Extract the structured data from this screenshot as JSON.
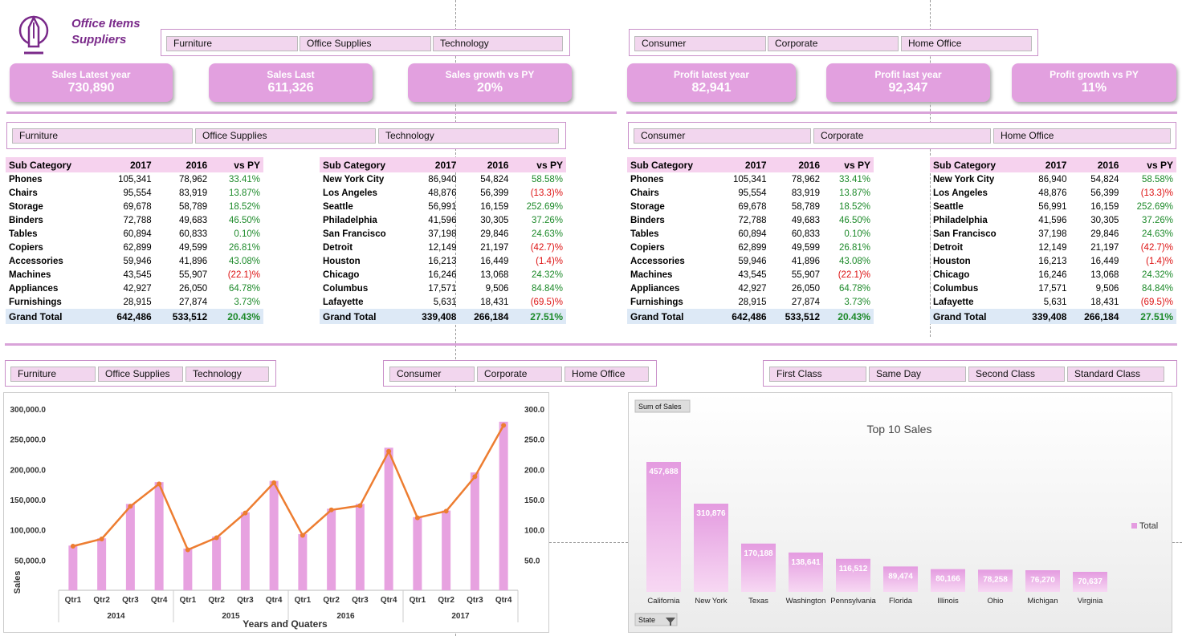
{
  "logo": {
    "line1": "Office Items",
    "line2": "Suppliers"
  },
  "slicers": {
    "category": [
      "Furniture",
      "Office Supplies",
      "Technology"
    ],
    "segment": [
      "Consumer",
      "Corporate",
      "Home Office"
    ],
    "ship_mode": [
      "First Class",
      "Same Day",
      "Second Class",
      "Standard Class"
    ]
  },
  "kpis": [
    {
      "title": "Sales Latest year",
      "value": "730,890"
    },
    {
      "title": "Sales Last",
      "value": "611,326"
    },
    {
      "title": "Sales growth vs PY",
      "value": "20%"
    },
    {
      "title": "Profit latest year",
      "value": "82,941"
    },
    {
      "title": "Profit  last year",
      "value": "92,347"
    },
    {
      "title": "Profit growth vs PY",
      "value": "11%"
    }
  ],
  "table_sub": {
    "headers": [
      "Sub Category",
      "2017",
      "2016",
      "vs PY"
    ],
    "rows": [
      [
        "Phones",
        "105,341",
        "78,962",
        "33.41%"
      ],
      [
        "Chairs",
        "95,554",
        "83,919",
        "13.87%"
      ],
      [
        "Storage",
        "69,678",
        "58,789",
        "18.52%"
      ],
      [
        "Binders",
        "72,788",
        "49,683",
        "46.50%"
      ],
      [
        "Tables",
        "60,894",
        "60,833",
        "0.10%"
      ],
      [
        "Copiers",
        "62,899",
        "49,599",
        "26.81%"
      ],
      [
        "Accessories",
        "59,946",
        "41,896",
        "43.08%"
      ],
      [
        "Machines",
        "43,545",
        "55,907",
        "(22.1)%"
      ],
      [
        "Appliances",
        "42,927",
        "26,050",
        "64.78%"
      ],
      [
        "Furnishings",
        "28,915",
        "27,874",
        "3.73%"
      ]
    ],
    "total": [
      "Grand Total",
      "642,486",
      "533,512",
      "20.43%"
    ]
  },
  "table_city": {
    "headers": [
      "Sub Category",
      "2017",
      "2016",
      "vs PY"
    ],
    "rows": [
      [
        "New York City",
        "86,940",
        "54,824",
        "58.58%"
      ],
      [
        "Los Angeles",
        "48,876",
        "56,399",
        "(13.3)%"
      ],
      [
        "Seattle",
        "56,991",
        "16,159",
        "252.69%"
      ],
      [
        "Philadelphia",
        "41,596",
        "30,305",
        "37.26%"
      ],
      [
        "San Francisco",
        "37,198",
        "29,846",
        "24.63%"
      ],
      [
        "Detroit",
        "12,149",
        "21,197",
        "(42.7)%"
      ],
      [
        "Houston",
        "16,213",
        "16,449",
        "(1.4)%"
      ],
      [
        "Chicago",
        "16,246",
        "13,068",
        "24.32%"
      ],
      [
        "Columbus",
        "17,571",
        "9,506",
        "84.84%"
      ],
      [
        "Lafayette",
        "5,631",
        "18,431",
        "(69.5)%"
      ]
    ],
    "total": [
      "Grand Total",
      "339,408",
      "266,184",
      "27.51%"
    ]
  },
  "colors": {
    "accent": "#e2a0df",
    "bar": "#e7a2e0",
    "line": "#ed7d31",
    "positive": "#1d8a2a",
    "negative": "#dd1111"
  },
  "chart_data": [
    {
      "type": "bar",
      "combo_line": true,
      "ylabel": "Sales",
      "xlabel": "Years and Quaters",
      "ylim": [
        0,
        300000
      ],
      "y_ticks_left": [
        "",
        "50,000.0",
        "100,000.0",
        "150,000.0",
        "200,000.0",
        "250,000.0",
        "300,000.0"
      ],
      "y_ticks_right": [
        "",
        "50.0",
        "100.0",
        "150.0",
        "200.0",
        "250.0",
        "300.0"
      ],
      "years": [
        "2014",
        "2015",
        "2016",
        "2017"
      ],
      "categories": [
        "Qtr1",
        "Qtr2",
        "Qtr3",
        "Qtr4",
        "Qtr1",
        "Qtr2",
        "Qtr3",
        "Qtr4",
        "Qtr1",
        "Qtr2",
        "Qtr3",
        "Qtr4",
        "Qtr1",
        "Qtr2",
        "Qtr3",
        "Qtr4"
      ],
      "values": [
        74000,
        86000,
        143000,
        179000,
        69000,
        89000,
        129000,
        181000,
        93000,
        135000,
        143000,
        236000,
        121000,
        132000,
        195000,
        279000
      ],
      "line_values": [
        73,
        85,
        139,
        176,
        67,
        87,
        128,
        178,
        91,
        133,
        140,
        230,
        120,
        131,
        188,
        273
      ]
    },
    {
      "type": "bar",
      "title": "Top 10 Sales",
      "field_button": "Sum of Sales",
      "axis_button": "State",
      "legend": "Total",
      "categories": [
        "California",
        "New York",
        "Texas",
        "Washington",
        "Pennsylvania",
        "Florida",
        "Illinois",
        "Ohio",
        "Michigan",
        "Virginia"
      ],
      "values": [
        457688,
        310876,
        170188,
        138641,
        116512,
        89474,
        80166,
        78258,
        76270,
        70637
      ],
      "labels": [
        "457,688",
        "310,876",
        "170,188",
        "138,641",
        "116,512",
        "89,474",
        "80,166",
        "78,258",
        "76,270",
        "70,637"
      ]
    }
  ]
}
